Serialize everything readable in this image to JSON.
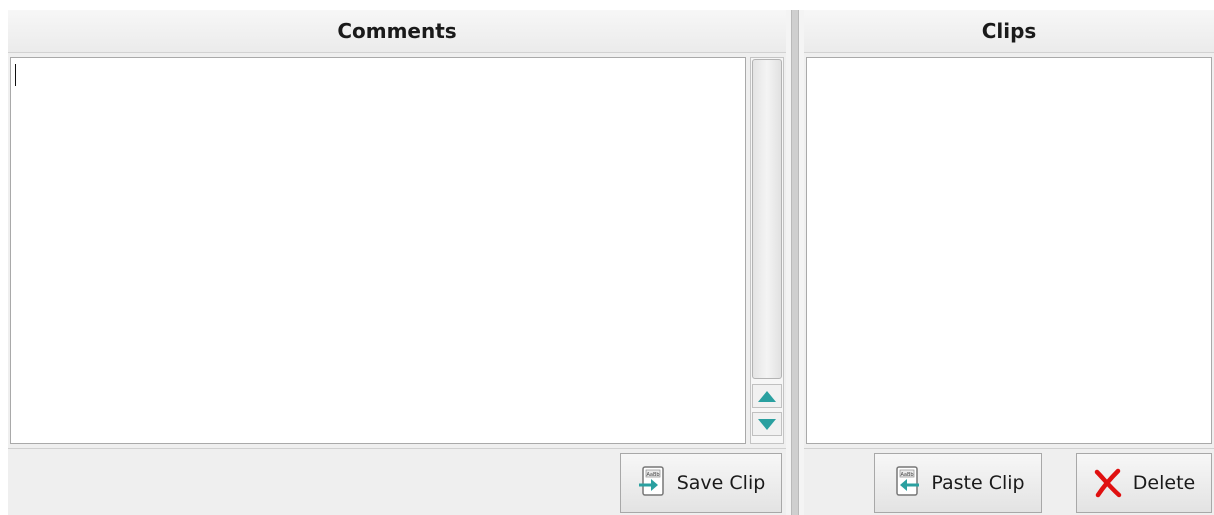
{
  "comments": {
    "header": "Comments",
    "text_value": "",
    "save_clip_label": "Save Clip"
  },
  "clips": {
    "header": "Clips",
    "items": [],
    "paste_clip_label": "Paste Clip",
    "delete_label": "Delete"
  },
  "icons": {
    "save_clip": "clip-save-icon",
    "paste_clip": "clip-paste-icon",
    "delete": "red-x-icon",
    "scroll_up": "triangle-up-icon",
    "scroll_down": "triangle-down-icon"
  },
  "colors": {
    "accent_teal": "#2aa0a0",
    "delete_red": "#e01010"
  }
}
